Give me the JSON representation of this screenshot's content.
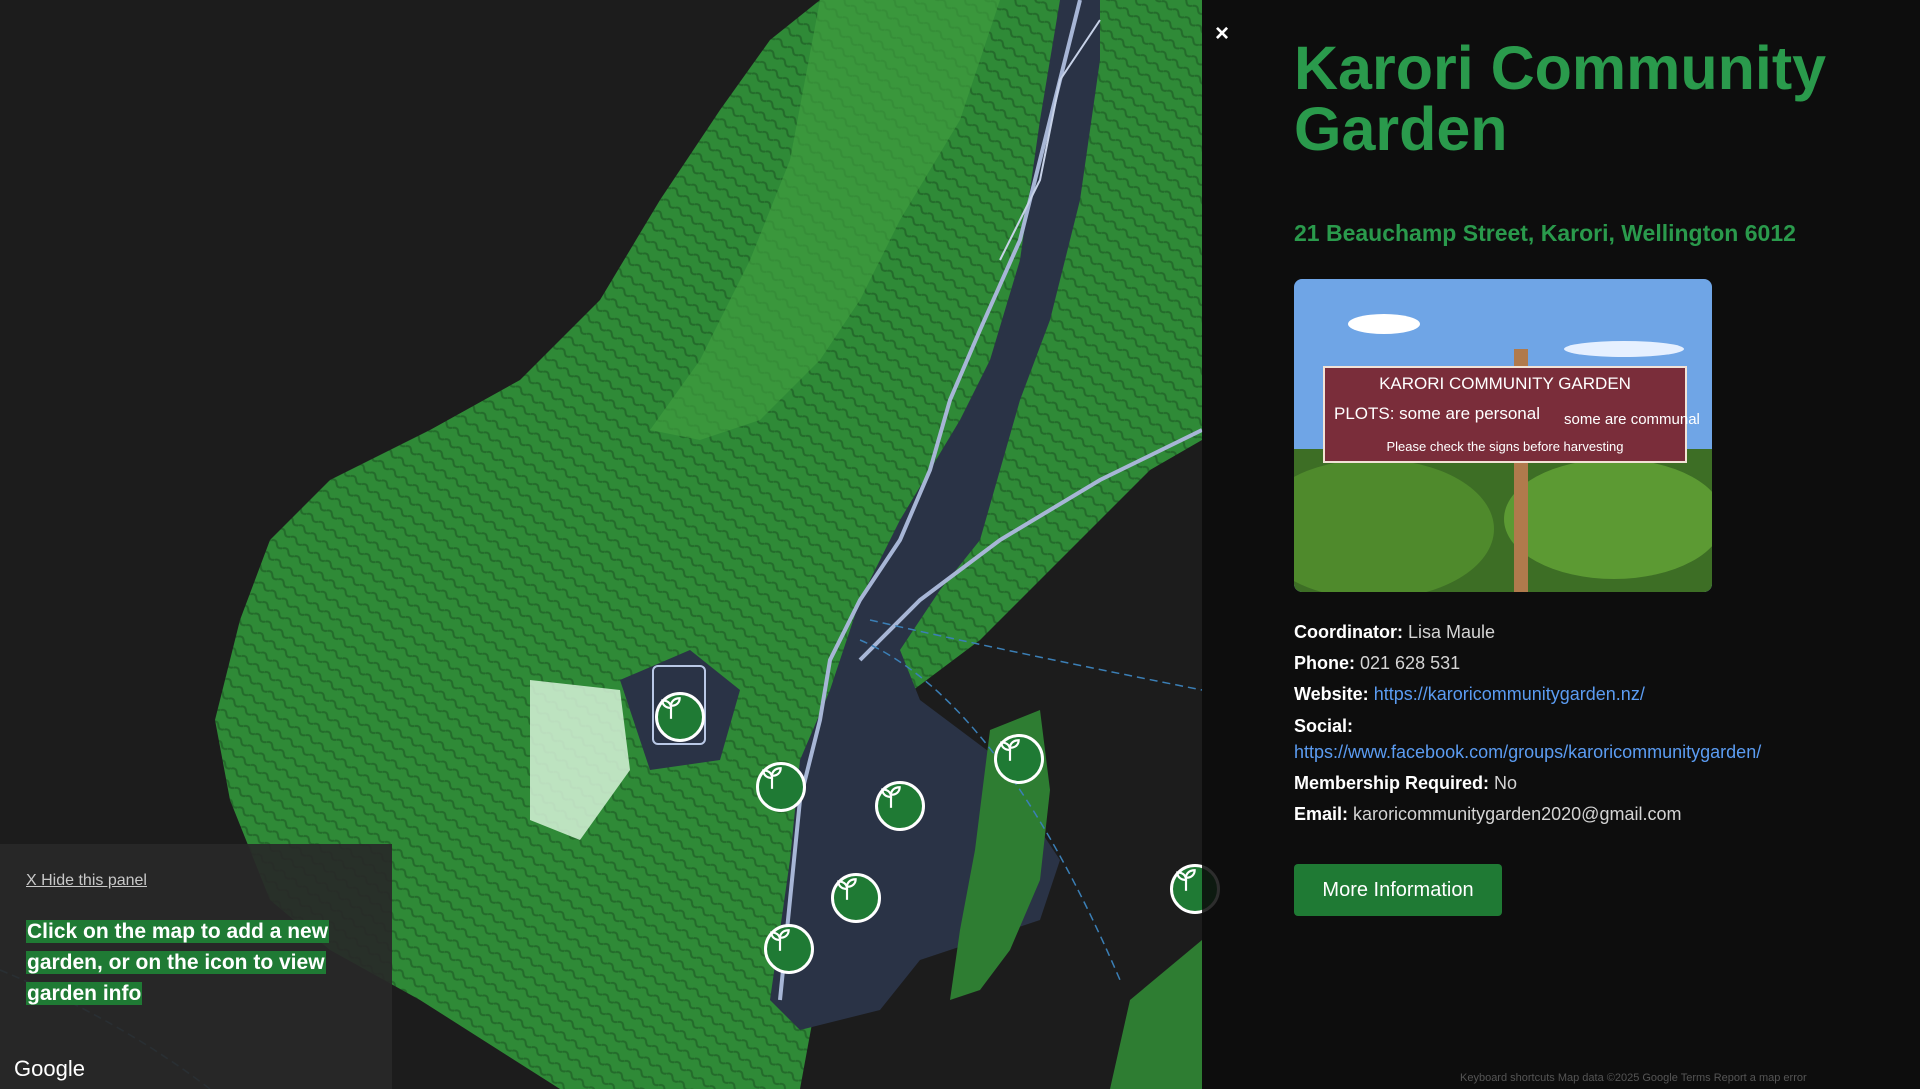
{
  "map": {
    "provider_logo": "Google",
    "footer_text": "Keyboard shortcuts  Map data ©2025 Google  Terms  Report a map error",
    "marker_icon": "seedling-icon",
    "marker_color": "#1f7a34",
    "land_color": "#2e7d32",
    "urban_color": "#2a3346",
    "water_color": "#1c1c1c"
  },
  "left_panel": {
    "hide_label": "X Hide this panel",
    "instruction": "Click on the map to add a new garden, or on the icon to view garden info"
  },
  "info_panel": {
    "close_label": "×",
    "title": "Karori Community Garden",
    "address": "21 Beauchamp Street, Karori, Wellington 6012",
    "photo_sign_lines": [
      "KARORI COMMUNITY GARDEN",
      "PLOTS: some are personal",
      "some are communal",
      "Please check the signs before harvesting"
    ],
    "coordinator_label": "Coordinator:",
    "coordinator": "Lisa Maule",
    "phone_label": "Phone:",
    "phone": "021 628 531",
    "website_label": "Website:",
    "website": "https://karoricommunitygarden.nz/",
    "social_label": "Social:",
    "social": "https://www.facebook.com/groups/karoricommunitygarden/",
    "membership_label": "Membership Required:",
    "membership": "No",
    "email_label": "Email:",
    "email": "karoricommunitygarden2020@gmail.com",
    "more_button": "More Information",
    "accent_color": "#2a9a4c",
    "link_color": "#5b9cf2"
  }
}
